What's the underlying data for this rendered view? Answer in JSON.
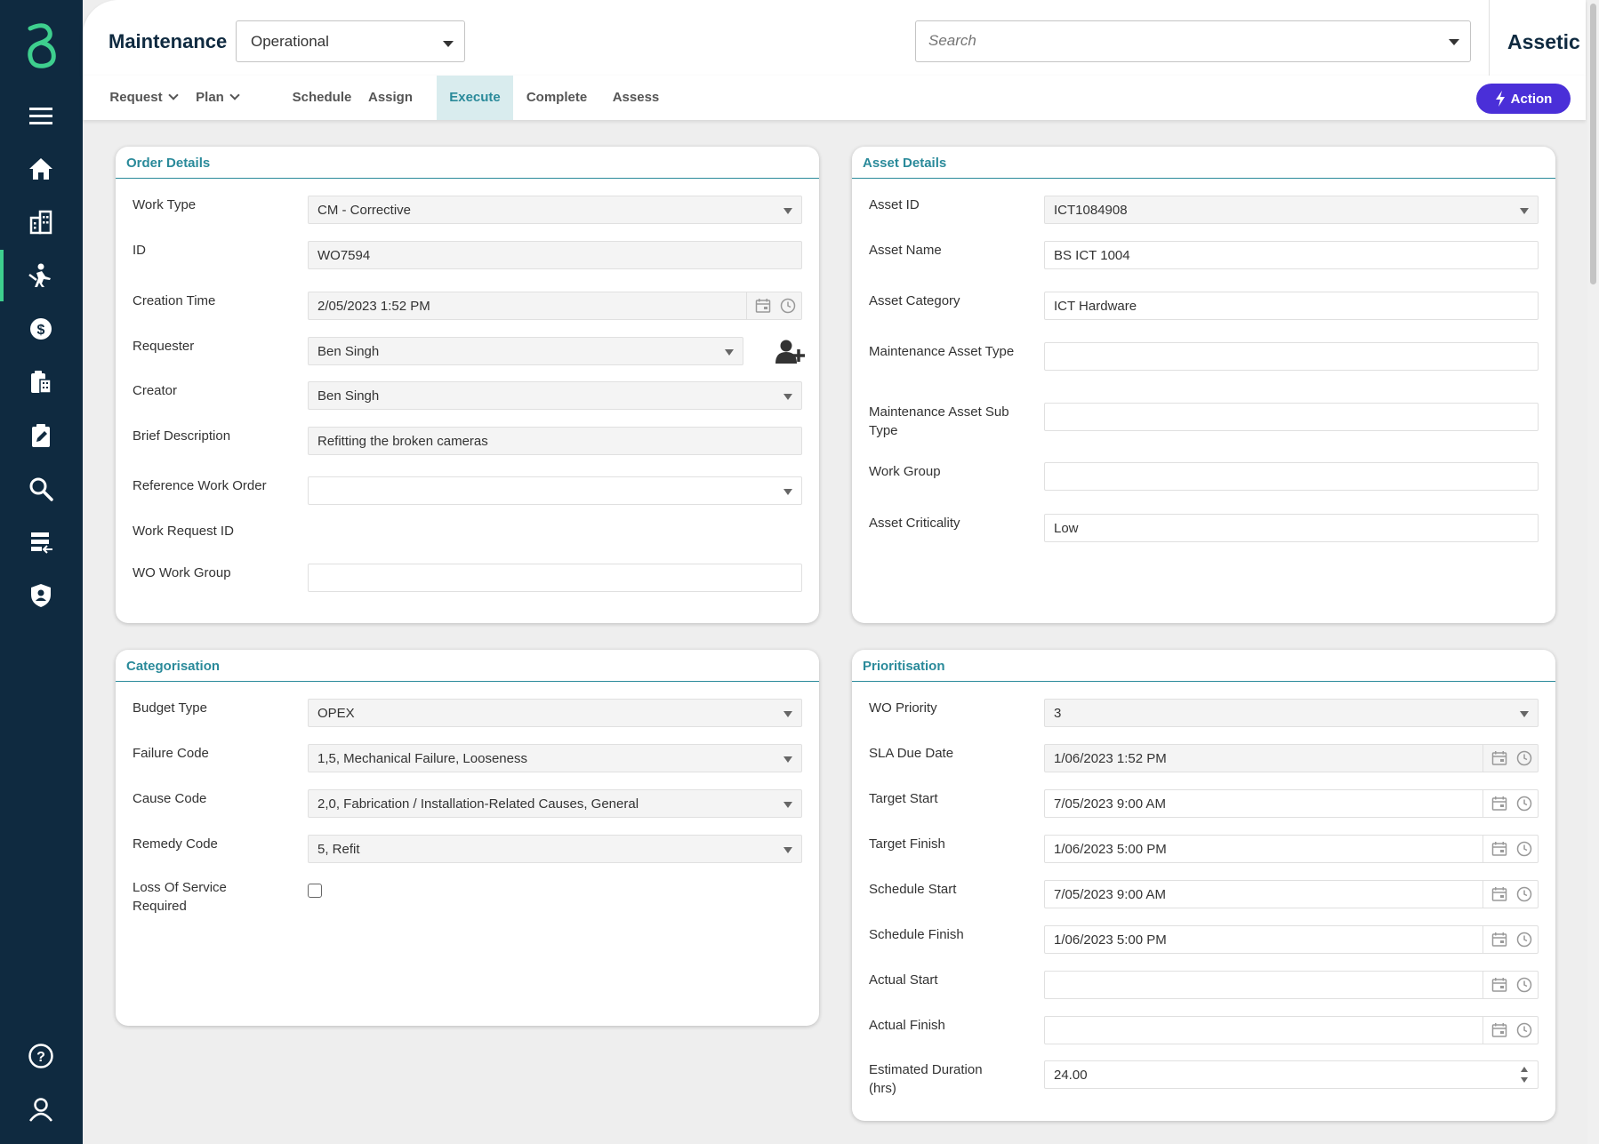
{
  "app": {
    "title": "Maintenance",
    "mode_value": "Operational",
    "search_placeholder": "Search",
    "brand": "Assetic"
  },
  "tabs": [
    {
      "label": "Request"
    },
    {
      "label": "Plan"
    },
    {
      "label": "Schedule"
    },
    {
      "label": "Assign"
    },
    {
      "label": "Execute"
    },
    {
      "label": "Complete"
    },
    {
      "label": "Assess"
    }
  ],
  "action_label": "Action",
  "order_details": {
    "title": "Order Details",
    "fields": [
      {
        "label": "Work Type",
        "value": "CM - Corrective"
      },
      {
        "label": "ID",
        "value": "WO7594"
      },
      {
        "label": "Creation Time",
        "value": "2/05/2023 1:52 PM"
      },
      {
        "label": "Requester",
        "value": "Ben Singh"
      },
      {
        "label": "Creator",
        "value": "Ben Singh"
      },
      {
        "label": "Brief Description",
        "value": "Refitting the broken cameras"
      },
      {
        "label": "Reference Work Order",
        "value": ""
      },
      {
        "label": "Work Request ID",
        "value": ""
      },
      {
        "label": "WO Work Group",
        "value": ""
      }
    ]
  },
  "asset_details": {
    "title": "Asset Details",
    "fields": [
      {
        "label": "Asset ID",
        "value": "ICT1084908"
      },
      {
        "label": "Asset Name",
        "value": "BS ICT 1004"
      },
      {
        "label": "Asset Category",
        "value": "ICT Hardware"
      },
      {
        "label": "Maintenance Asset Type",
        "value": ""
      },
      {
        "label": "Maintenance Asset Sub Type",
        "value": ""
      },
      {
        "label": "Work Group",
        "value": ""
      },
      {
        "label": "Asset Criticality",
        "value": "Low"
      }
    ]
  },
  "categorisation": {
    "title": "Categorisation",
    "fields": [
      {
        "label": "Budget Type",
        "value": "OPEX"
      },
      {
        "label": "Failure Code",
        "value": "1,5, Mechanical Failure, Looseness"
      },
      {
        "label": "Cause Code",
        "value": "2,0, Fabrication / Installation-Related Causes, General"
      },
      {
        "label": "Remedy Code",
        "value": "5, Refit"
      },
      {
        "label": "Loss Of Service Required",
        "value": ""
      }
    ]
  },
  "prioritisation": {
    "title": "Prioritisation",
    "fields": [
      {
        "label": "WO Priority",
        "value": "3"
      },
      {
        "label": "SLA Due Date",
        "value": "1/06/2023 1:52 PM"
      },
      {
        "label": "Target Start",
        "value": "7/05/2023 9:00 AM"
      },
      {
        "label": "Target Finish",
        "value": "1/06/2023 5:00 PM"
      },
      {
        "label": "Schedule Start",
        "value": "7/05/2023 9:00 AM"
      },
      {
        "label": "Schedule Finish",
        "value": "1/06/2023 5:00 PM"
      },
      {
        "label": "Actual Start",
        "value": ""
      },
      {
        "label": "Actual Finish",
        "value": ""
      },
      {
        "label": "Estimated Duration (hrs)",
        "value": "24.00"
      }
    ]
  },
  "colors": {
    "sidebar": "#0f2a40",
    "accent_teal": "#2a8a9a",
    "logo_green": "#3ecf8e",
    "action_purple": "#4a2fd8"
  },
  "sidebar_icons": [
    "menu-icon",
    "home-icon",
    "buildings-icon",
    "worker-icon",
    "dollar-icon",
    "clipboard-building-icon",
    "clipboard-edit-icon",
    "search-icon",
    "list-arrow-icon",
    "shield-user-icon",
    "help-icon",
    "user-icon"
  ]
}
